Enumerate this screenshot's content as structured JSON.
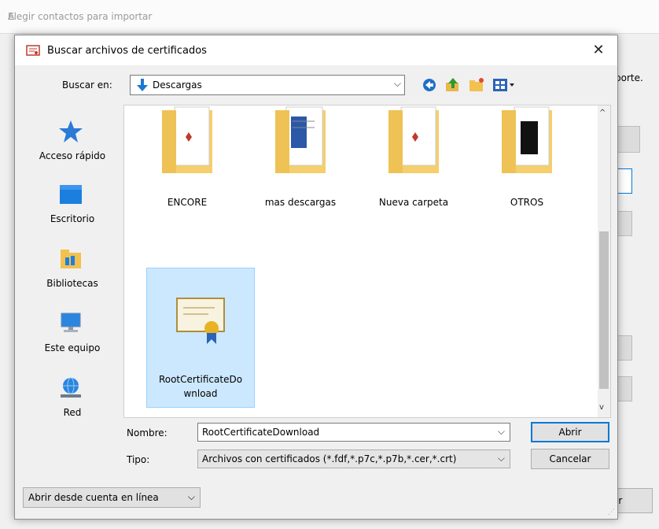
{
  "parent": {
    "title": "Elegir contactos para importar",
    "partial_text": "porte.",
    "bottom_button": "ir",
    "side_mark": "A"
  },
  "dialog": {
    "title": "Buscar archivos de certificados",
    "close": "✕",
    "look_in_label": "Buscar en:",
    "look_in_value": "Descargas",
    "chevron": "⌵",
    "places": [
      {
        "label": "Acceso rápido",
        "icon": "star-icon"
      },
      {
        "label": "Escritorio",
        "icon": "desktop-icon"
      },
      {
        "label": "Bibliotecas",
        "icon": "libraries-icon"
      },
      {
        "label": "Este equipo",
        "icon": "computer-icon"
      },
      {
        "label": "Red",
        "icon": "network-icon"
      }
    ],
    "files": [
      {
        "label": "ENCORE",
        "icon": "folder-icon"
      },
      {
        "label": "mas descargas",
        "icon": "folder-icon"
      },
      {
        "label": "Nueva carpeta",
        "icon": "folder-icon"
      },
      {
        "label": "OTROS",
        "icon": "folder-icon"
      },
      {
        "label": "RootCertificateDownload",
        "label_line1": "RootCertificateDo",
        "label_line2": "wnload",
        "icon": "certificate-icon",
        "selected": true
      }
    ],
    "filename_label": "Nombre:",
    "filename_value": "RootCertificateDownload",
    "filetype_label": "Tipo:",
    "filetype_value": "Archivos con certificados (*.fdf,*.p7c,*.p7b,*.cer,*.crt)",
    "open_button": "Abrir",
    "cancel_button": "Cancelar",
    "online_button": "Abrir desde cuenta en línea",
    "scroll_up": "^",
    "scroll_down": "v"
  },
  "colors": {
    "selection": "#cce8ff",
    "accent": "#0078d7"
  }
}
